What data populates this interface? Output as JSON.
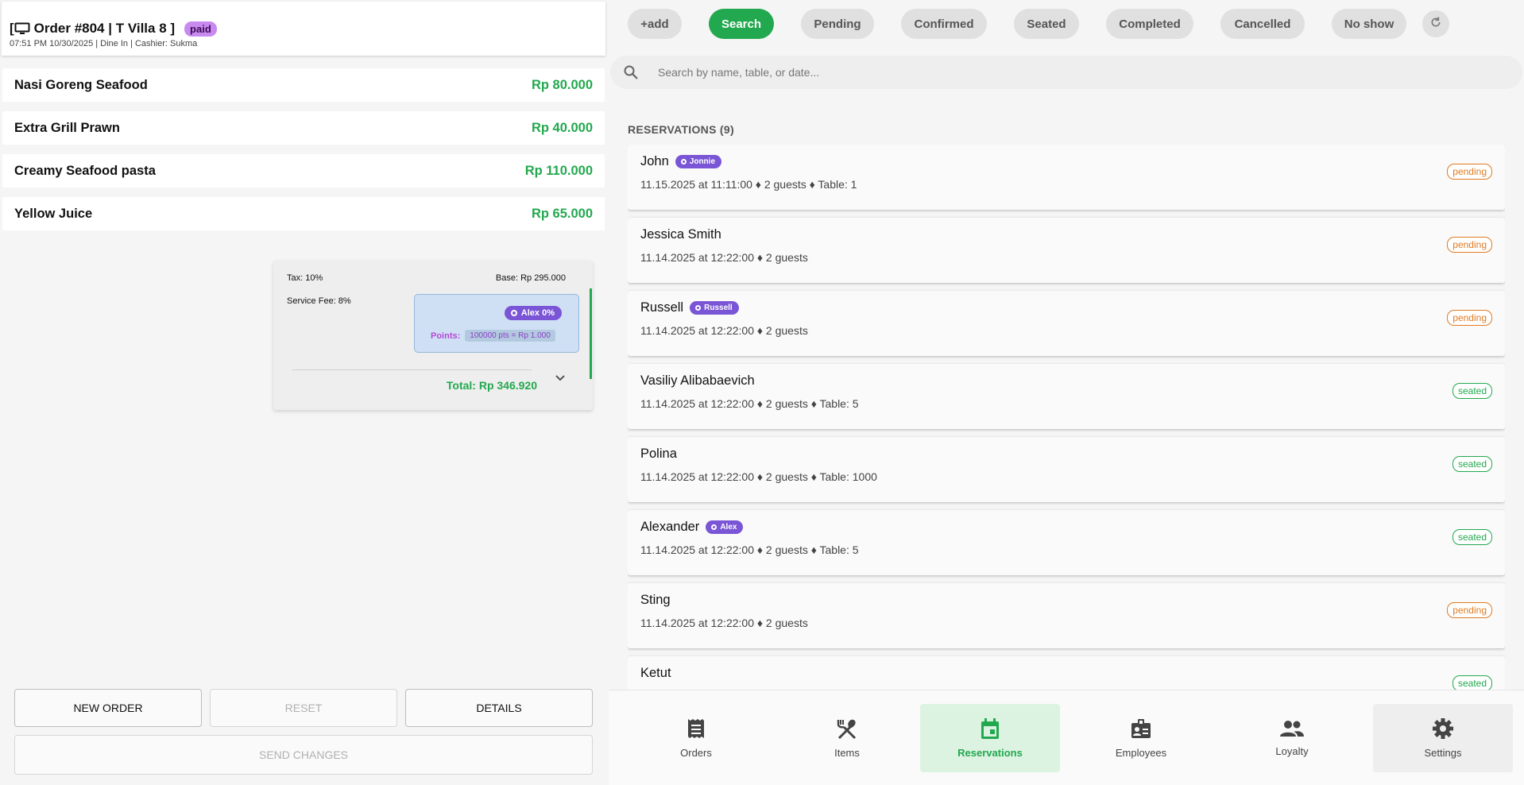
{
  "order": {
    "title": "Order #804 | T Villa 8 ]",
    "status_badge": "paid",
    "meta": "07:51 PM 10/30/2025 | Dine In | Cashier: Sukma",
    "items": [
      {
        "name": "Nasi Goreng Seafood",
        "price": "Rp 80.000"
      },
      {
        "name": "Extra Grill Prawn",
        "price": "Rp 40.000"
      },
      {
        "name": "Creamy Seafood pasta",
        "price": "Rp 110.000"
      },
      {
        "name": "Yellow Juice",
        "price": "Rp 65.000"
      }
    ],
    "summary": {
      "tax": "Tax: 10%",
      "base": "Base: Rp 295.000",
      "service_fee": "Service Fee: 8%",
      "loyalty_chip": "Alex 0%",
      "points_label": "Points:",
      "points_value": "100000 pts = Rp 1.000",
      "total": "Total: Rp 346.920"
    },
    "buttons": {
      "new_order": "NEW ORDER",
      "reset": "RESET",
      "details": "DETAILS",
      "send_changes": "SEND CHANGES"
    }
  },
  "filters": {
    "add": "+add",
    "search": "Search",
    "pending": "Pending",
    "confirmed": "Confirmed",
    "seated": "Seated",
    "completed": "Completed",
    "cancelled": "Cancelled",
    "no_show": "No show"
  },
  "search": {
    "placeholder": "Search by name, table, or date..."
  },
  "reservations": {
    "heading": "RESERVATIONS (9)",
    "items": [
      {
        "name": "John",
        "tag": "Jonnie",
        "details": "11.15.2025 at 11:11:00 ♦ 2 guests ♦ Table: 1",
        "status": "pending"
      },
      {
        "name": "Jessica Smith",
        "tag": "",
        "details": "11.14.2025 at 12:22:00 ♦ 2 guests",
        "status": "pending"
      },
      {
        "name": "Russell",
        "tag": "Russell",
        "details": "11.14.2025 at 12:22:00 ♦ 2 guests",
        "status": "pending"
      },
      {
        "name": "Vasiliy Alibabaevich",
        "tag": "",
        "details": "11.14.2025 at 12:22:00 ♦ 2 guests ♦ Table: 5",
        "status": "seated"
      },
      {
        "name": "Polina",
        "tag": "",
        "details": "11.14.2025 at 12:22:00 ♦ 2 guests ♦ Table: 1000",
        "status": "seated"
      },
      {
        "name": "Alexander",
        "tag": "Alex",
        "details": "11.14.2025 at 12:22:00 ♦ 2 guests ♦ Table: 5",
        "status": "seated"
      },
      {
        "name": "Sting",
        "tag": "",
        "details": "11.14.2025 at 12:22:00 ♦ 2 guests",
        "status": "pending"
      },
      {
        "name": "Ketut",
        "tag": "",
        "details": "",
        "status": "seated"
      }
    ]
  },
  "nav": {
    "orders": "Orders",
    "items": "Items",
    "reservations": "Reservations",
    "employees": "Employees",
    "loyalty": "Loyalty",
    "settings": "Settings"
  },
  "colors": {
    "accent_green": "#22a84e",
    "paid_badge": "#c98af0",
    "pending": "#e07a1f",
    "loyalty_chip": "#7a55d6"
  }
}
